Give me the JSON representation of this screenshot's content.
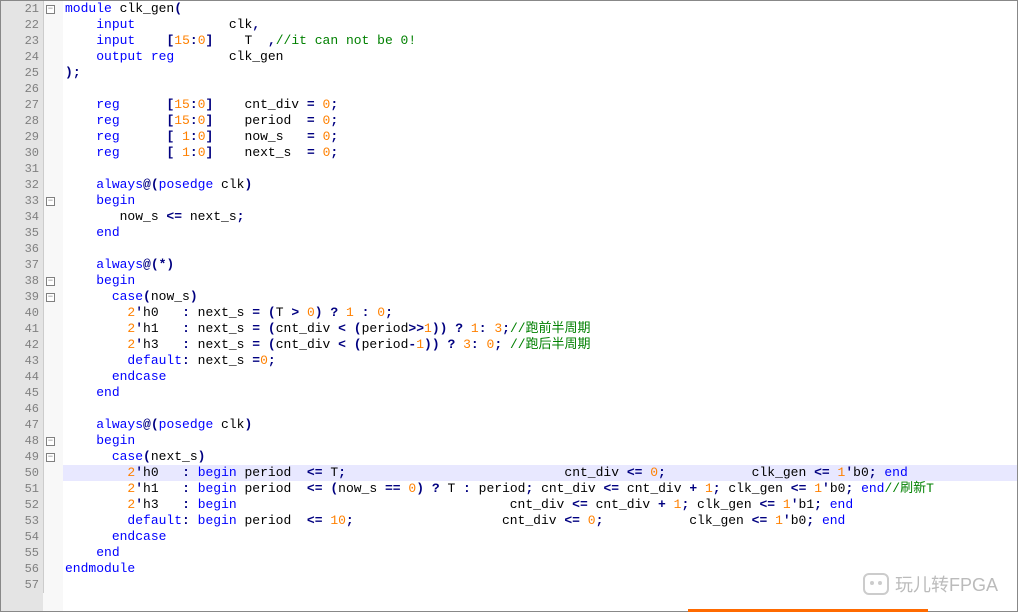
{
  "lines": [
    {
      "n": 21,
      "fold": "box",
      "tokens": [
        [
          "kw",
          "module"
        ],
        [
          "id",
          " clk_gen"
        ],
        [
          "op",
          "("
        ]
      ]
    },
    {
      "n": 22,
      "tokens": [
        [
          "id",
          "    "
        ],
        [
          "kw",
          "input"
        ],
        [
          "id",
          "            clk"
        ],
        [
          "op",
          ","
        ]
      ]
    },
    {
      "n": 23,
      "tokens": [
        [
          "id",
          "    "
        ],
        [
          "kw",
          "input"
        ],
        [
          "id",
          "    "
        ],
        [
          "op",
          "["
        ],
        [
          "num",
          "15"
        ],
        [
          "op",
          ":"
        ],
        [
          "num",
          "0"
        ],
        [
          "op",
          "]"
        ],
        [
          "id",
          "    T  "
        ],
        [
          "op",
          ","
        ],
        [
          "com",
          "//it can not be 0!"
        ]
      ]
    },
    {
      "n": 24,
      "tokens": [
        [
          "id",
          "    "
        ],
        [
          "kw",
          "output reg"
        ],
        [
          "id",
          "       clk_gen"
        ]
      ]
    },
    {
      "n": 25,
      "tokens": [
        [
          "op",
          ")"
        ],
        [
          "op",
          ";"
        ]
      ]
    },
    {
      "n": 26,
      "tokens": [
        [
          "id",
          ""
        ]
      ]
    },
    {
      "n": 27,
      "tokens": [
        [
          "id",
          "    "
        ],
        [
          "kw",
          "reg"
        ],
        [
          "id",
          "      "
        ],
        [
          "op",
          "["
        ],
        [
          "num",
          "15"
        ],
        [
          "op",
          ":"
        ],
        [
          "num",
          "0"
        ],
        [
          "op",
          "]"
        ],
        [
          "id",
          "    cnt_div "
        ],
        [
          "op",
          "="
        ],
        [
          "id",
          " "
        ],
        [
          "num",
          "0"
        ],
        [
          "op",
          ";"
        ]
      ]
    },
    {
      "n": 28,
      "tokens": [
        [
          "id",
          "    "
        ],
        [
          "kw",
          "reg"
        ],
        [
          "id",
          "      "
        ],
        [
          "op",
          "["
        ],
        [
          "num",
          "15"
        ],
        [
          "op",
          ":"
        ],
        [
          "num",
          "0"
        ],
        [
          "op",
          "]"
        ],
        [
          "id",
          "    period  "
        ],
        [
          "op",
          "="
        ],
        [
          "id",
          " "
        ],
        [
          "num",
          "0"
        ],
        [
          "op",
          ";"
        ]
      ]
    },
    {
      "n": 29,
      "tokens": [
        [
          "id",
          "    "
        ],
        [
          "kw",
          "reg"
        ],
        [
          "id",
          "      "
        ],
        [
          "op",
          "["
        ],
        [
          "id",
          " "
        ],
        [
          "num",
          "1"
        ],
        [
          "op",
          ":"
        ],
        [
          "num",
          "0"
        ],
        [
          "op",
          "]"
        ],
        [
          "id",
          "    now_s   "
        ],
        [
          "op",
          "="
        ],
        [
          "id",
          " "
        ],
        [
          "num",
          "0"
        ],
        [
          "op",
          ";"
        ]
      ]
    },
    {
      "n": 30,
      "tokens": [
        [
          "id",
          "    "
        ],
        [
          "kw",
          "reg"
        ],
        [
          "id",
          "      "
        ],
        [
          "op",
          "["
        ],
        [
          "id",
          " "
        ],
        [
          "num",
          "1"
        ],
        [
          "op",
          ":"
        ],
        [
          "num",
          "0"
        ],
        [
          "op",
          "]"
        ],
        [
          "id",
          "    next_s  "
        ],
        [
          "op",
          "="
        ],
        [
          "id",
          " "
        ],
        [
          "num",
          "0"
        ],
        [
          "op",
          ";"
        ]
      ]
    },
    {
      "n": 31,
      "tokens": [
        [
          "id",
          ""
        ]
      ]
    },
    {
      "n": 32,
      "tokens": [
        [
          "id",
          "    "
        ],
        [
          "kw",
          "always"
        ],
        [
          "op",
          "@("
        ],
        [
          "kw",
          "posedge"
        ],
        [
          "id",
          " clk"
        ],
        [
          "op",
          ")"
        ]
      ]
    },
    {
      "n": 33,
      "fold": "box",
      "tokens": [
        [
          "id",
          "    "
        ],
        [
          "kw",
          "begin"
        ]
      ]
    },
    {
      "n": 34,
      "tokens": [
        [
          "id",
          "       now_s "
        ],
        [
          "op",
          "<="
        ],
        [
          "id",
          " next_s"
        ],
        [
          "op",
          ";"
        ]
      ]
    },
    {
      "n": 35,
      "tokens": [
        [
          "id",
          "    "
        ],
        [
          "kw",
          "end"
        ]
      ]
    },
    {
      "n": 36,
      "tokens": [
        [
          "id",
          ""
        ]
      ]
    },
    {
      "n": 37,
      "tokens": [
        [
          "id",
          "    "
        ],
        [
          "kw",
          "always"
        ],
        [
          "op",
          "@(*)"
        ]
      ]
    },
    {
      "n": 38,
      "fold": "box",
      "tokens": [
        [
          "id",
          "    "
        ],
        [
          "kw",
          "begin"
        ]
      ]
    },
    {
      "n": 39,
      "fold": "box",
      "tokens": [
        [
          "id",
          "      "
        ],
        [
          "kw",
          "case"
        ],
        [
          "op",
          "("
        ],
        [
          "id",
          "now_s"
        ],
        [
          "op",
          ")"
        ]
      ]
    },
    {
      "n": 40,
      "tokens": [
        [
          "id",
          "        "
        ],
        [
          "num",
          "2"
        ],
        [
          "op",
          "'"
        ],
        [
          "id",
          "h0   "
        ],
        [
          "op",
          ":"
        ],
        [
          "id",
          " next_s "
        ],
        [
          "op",
          "="
        ],
        [
          "id",
          " "
        ],
        [
          "op",
          "("
        ],
        [
          "id",
          "T "
        ],
        [
          "op",
          ">"
        ],
        [
          "id",
          " "
        ],
        [
          "num",
          "0"
        ],
        [
          "op",
          ")"
        ],
        [
          "id",
          " "
        ],
        [
          "op",
          "?"
        ],
        [
          "id",
          " "
        ],
        [
          "num",
          "1"
        ],
        [
          "id",
          " "
        ],
        [
          "op",
          ":"
        ],
        [
          "id",
          " "
        ],
        [
          "num",
          "0"
        ],
        [
          "op",
          ";"
        ]
      ]
    },
    {
      "n": 41,
      "tokens": [
        [
          "id",
          "        "
        ],
        [
          "num",
          "2"
        ],
        [
          "op",
          "'"
        ],
        [
          "id",
          "h1   "
        ],
        [
          "op",
          ":"
        ],
        [
          "id",
          " next_s "
        ],
        [
          "op",
          "="
        ],
        [
          "id",
          " "
        ],
        [
          "op",
          "("
        ],
        [
          "id",
          "cnt_div "
        ],
        [
          "op",
          "<"
        ],
        [
          "id",
          " "
        ],
        [
          "op",
          "("
        ],
        [
          "id",
          "period"
        ],
        [
          "op",
          ">>"
        ],
        [
          "num",
          "1"
        ],
        [
          "op",
          "))"
        ],
        [
          "id",
          " "
        ],
        [
          "op",
          "?"
        ],
        [
          "id",
          " "
        ],
        [
          "num",
          "1"
        ],
        [
          "op",
          ":"
        ],
        [
          "id",
          " "
        ],
        [
          "num",
          "3"
        ],
        [
          "op",
          ";"
        ],
        [
          "com",
          "//跑前半周期"
        ]
      ]
    },
    {
      "n": 42,
      "tokens": [
        [
          "id",
          "        "
        ],
        [
          "num",
          "2"
        ],
        [
          "op",
          "'"
        ],
        [
          "id",
          "h3   "
        ],
        [
          "op",
          ":"
        ],
        [
          "id",
          " next_s "
        ],
        [
          "op",
          "="
        ],
        [
          "id",
          " "
        ],
        [
          "op",
          "("
        ],
        [
          "id",
          "cnt_div "
        ],
        [
          "op",
          "<"
        ],
        [
          "id",
          " "
        ],
        [
          "op",
          "("
        ],
        [
          "id",
          "period"
        ],
        [
          "op",
          "-"
        ],
        [
          "num",
          "1"
        ],
        [
          "op",
          "))"
        ],
        [
          "id",
          " "
        ],
        [
          "op",
          "?"
        ],
        [
          "id",
          " "
        ],
        [
          "num",
          "3"
        ],
        [
          "op",
          ":"
        ],
        [
          "id",
          " "
        ],
        [
          "num",
          "0"
        ],
        [
          "op",
          ";"
        ],
        [
          "id",
          " "
        ],
        [
          "com",
          "//跑后半周期"
        ]
      ]
    },
    {
      "n": 43,
      "tokens": [
        [
          "id",
          "        "
        ],
        [
          "kw",
          "default"
        ],
        [
          "op",
          ":"
        ],
        [
          "id",
          " next_s "
        ],
        [
          "op",
          "="
        ],
        [
          "num",
          "0"
        ],
        [
          "op",
          ";"
        ]
      ]
    },
    {
      "n": 44,
      "tokens": [
        [
          "id",
          "      "
        ],
        [
          "kw",
          "endcase"
        ]
      ]
    },
    {
      "n": 45,
      "tokens": [
        [
          "id",
          "    "
        ],
        [
          "kw",
          "end"
        ]
      ]
    },
    {
      "n": 46,
      "tokens": [
        [
          "id",
          ""
        ]
      ]
    },
    {
      "n": 47,
      "tokens": [
        [
          "id",
          "    "
        ],
        [
          "kw",
          "always"
        ],
        [
          "op",
          "@("
        ],
        [
          "kw",
          "posedge"
        ],
        [
          "id",
          " clk"
        ],
        [
          "op",
          ")"
        ]
      ]
    },
    {
      "n": 48,
      "fold": "box",
      "tokens": [
        [
          "id",
          "    "
        ],
        [
          "kw",
          "begin"
        ]
      ]
    },
    {
      "n": 49,
      "fold": "box",
      "hlred": true,
      "tokens": [
        [
          "id",
          "      "
        ],
        [
          "kw",
          "case"
        ],
        [
          "op",
          "("
        ],
        [
          "id",
          "next_s"
        ],
        [
          "op",
          ")"
        ]
      ]
    },
    {
      "n": 50,
      "hl": true,
      "hlred": true,
      "tokens": [
        [
          "id",
          "        "
        ],
        [
          "num",
          "2"
        ],
        [
          "op",
          "'"
        ],
        [
          "id",
          "h0   "
        ],
        [
          "op",
          ":"
        ],
        [
          "id",
          " "
        ],
        [
          "kw",
          "begin"
        ],
        [
          "id",
          " period  "
        ],
        [
          "op",
          "<="
        ],
        [
          "id",
          " T"
        ],
        [
          "op",
          ";"
        ],
        [
          "id",
          "                            cnt_div "
        ],
        [
          "op",
          "<="
        ],
        [
          "id",
          " "
        ],
        [
          "num",
          "0"
        ],
        [
          "op",
          ";"
        ],
        [
          "id",
          "           clk_gen "
        ],
        [
          "op",
          "<="
        ],
        [
          "id",
          " "
        ],
        [
          "num",
          "1"
        ],
        [
          "op",
          "'"
        ],
        [
          "id",
          "b0"
        ],
        [
          "op",
          ";"
        ],
        [
          "id",
          " "
        ],
        [
          "kw",
          "end"
        ]
      ]
    },
    {
      "n": 51,
      "hlred": true,
      "tokens": [
        [
          "id",
          "        "
        ],
        [
          "num",
          "2"
        ],
        [
          "op",
          "'"
        ],
        [
          "id",
          "h1   "
        ],
        [
          "op",
          ":"
        ],
        [
          "id",
          " "
        ],
        [
          "kw",
          "begin"
        ],
        [
          "id",
          " period  "
        ],
        [
          "op",
          "<="
        ],
        [
          "id",
          " "
        ],
        [
          "op",
          "("
        ],
        [
          "id",
          "now_s "
        ],
        [
          "op",
          "=="
        ],
        [
          "id",
          " "
        ],
        [
          "num",
          "0"
        ],
        [
          "op",
          ")"
        ],
        [
          "id",
          " "
        ],
        [
          "op",
          "?"
        ],
        [
          "id",
          " T "
        ],
        [
          "op",
          ":"
        ],
        [
          "id",
          " period"
        ],
        [
          "op",
          ";"
        ],
        [
          "id",
          " cnt_div "
        ],
        [
          "op",
          "<="
        ],
        [
          "id",
          " cnt_div "
        ],
        [
          "op",
          "+"
        ],
        [
          "id",
          " "
        ],
        [
          "num",
          "1"
        ],
        [
          "op",
          ";"
        ],
        [
          "id",
          " clk_gen "
        ],
        [
          "op",
          "<="
        ],
        [
          "id",
          " "
        ],
        [
          "num",
          "1"
        ],
        [
          "op",
          "'"
        ],
        [
          "id",
          "b0"
        ],
        [
          "op",
          ";"
        ],
        [
          "id",
          " "
        ],
        [
          "kw",
          "end"
        ],
        [
          "com",
          "//刷新T"
        ]
      ]
    },
    {
      "n": 52,
      "hlred": true,
      "tokens": [
        [
          "id",
          "        "
        ],
        [
          "num",
          "2"
        ],
        [
          "op",
          "'"
        ],
        [
          "id",
          "h3   "
        ],
        [
          "op",
          ":"
        ],
        [
          "id",
          " "
        ],
        [
          "kw",
          "begin"
        ],
        [
          "id",
          "                                   cnt_div "
        ],
        [
          "op",
          "<="
        ],
        [
          "id",
          " cnt_div "
        ],
        [
          "op",
          "+"
        ],
        [
          "id",
          " "
        ],
        [
          "num",
          "1"
        ],
        [
          "op",
          ";"
        ],
        [
          "id",
          " clk_gen "
        ],
        [
          "op",
          "<="
        ],
        [
          "id",
          " "
        ],
        [
          "num",
          "1"
        ],
        [
          "op",
          "'"
        ],
        [
          "id",
          "b1"
        ],
        [
          "op",
          ";"
        ],
        [
          "id",
          " "
        ],
        [
          "kw",
          "end"
        ]
      ]
    },
    {
      "n": 53,
      "hlred": true,
      "tokens": [
        [
          "id",
          "        "
        ],
        [
          "kw",
          "default"
        ],
        [
          "op",
          ":"
        ],
        [
          "id",
          " "
        ],
        [
          "kw",
          "begin"
        ],
        [
          "id",
          " period  "
        ],
        [
          "op",
          "<="
        ],
        [
          "id",
          " "
        ],
        [
          "num",
          "10"
        ],
        [
          "op",
          ";"
        ],
        [
          "id",
          "                   cnt_div "
        ],
        [
          "op",
          "<="
        ],
        [
          "id",
          " "
        ],
        [
          "num",
          "0"
        ],
        [
          "op",
          ";"
        ],
        [
          "id",
          "           clk_gen "
        ],
        [
          "op",
          "<="
        ],
        [
          "id",
          " "
        ],
        [
          "num",
          "1"
        ],
        [
          "op",
          "'"
        ],
        [
          "id",
          "b0"
        ],
        [
          "op",
          ";"
        ],
        [
          "id",
          " "
        ],
        [
          "kw",
          "end"
        ]
      ]
    },
    {
      "n": 54,
      "tokens": [
        [
          "id",
          "      "
        ],
        [
          "kw",
          "endcase"
        ]
      ]
    },
    {
      "n": 55,
      "tokens": [
        [
          "id",
          "    "
        ],
        [
          "kw",
          "end"
        ]
      ]
    },
    {
      "n": 56,
      "tokens": [
        [
          "kw",
          "endmodule"
        ]
      ]
    },
    {
      "n": 57,
      "tokens": [
        [
          "id",
          ""
        ]
      ]
    }
  ],
  "watermark": "玩儿转FPGA"
}
